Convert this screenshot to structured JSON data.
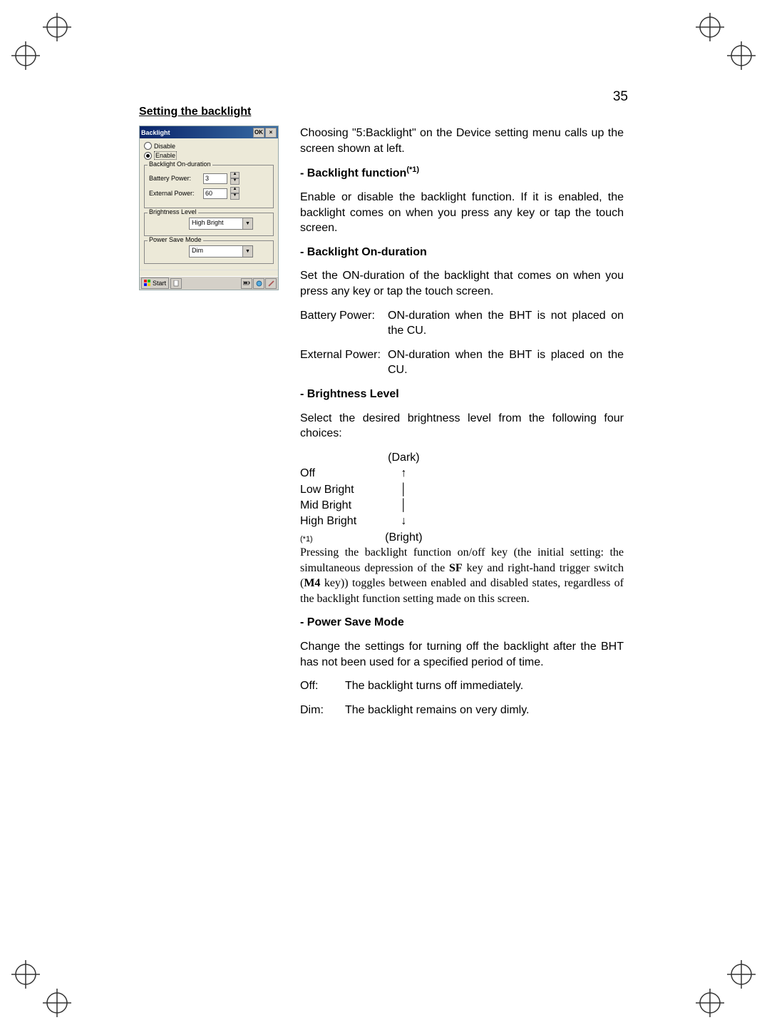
{
  "page_number": "35",
  "section_title": "Setting the backlight",
  "right": {
    "intro": "Choosing \"5:Backlight\" on the Device setting menu calls up the screen shown at left.",
    "h_function": "- Backlight function",
    "sup1": "(*1)",
    "p_function": "Enable or disable the backlight function. If it is enabled, the backlight comes on when you press any key or tap the touch screen.",
    "h_duration": "- Backlight On-duration",
    "p_duration": "Set the ON-duration of the backlight that comes on when you press any key or tap the touch screen.",
    "battery_label": "Battery Power:",
    "battery_desc": "ON-duration when the BHT is not placed on the CU.",
    "external_label": "External Power:",
    "external_desc": "ON-duration when the BHT is placed on the CU.",
    "h_brightness": "- Brightness Level",
    "p_brightness": "Select the desired brightness level from the following four choices:",
    "bl_dark": "(Dark)",
    "bl_bright": "(Bright)",
    "bl_off": "Off",
    "bl_low": "Low Bright",
    "bl_mid": "Mid Bright",
    "bl_high": "High Bright",
    "bl_up": "↑",
    "bl_pipe": "│",
    "bl_down": "↓",
    "footnote_marker": "(*1)",
    "footnote_pre": "Pressing the backlight function on/off key (the initial setting: the simultaneous depression of the ",
    "footnote_sf": "SF",
    "footnote_mid": " key and right-hand trigger switch (",
    "footnote_m4": "M4",
    "footnote_post": " key)) toggles between enabled and disabled states, regardless of the backlight function setting made on this screen.",
    "h_powersave": "- Power Save Mode",
    "p_powersave": "Change the settings for turning off the backlight after the BHT has not been used for a specified period of time.",
    "off_label": "Off:",
    "off_desc": "The backlight turns off immediately.",
    "dim_label": "Dim:",
    "dim_desc": "The backlight remains on very dimly."
  },
  "screenshot": {
    "title": "Backlight",
    "ok": "OK",
    "close": "×",
    "disable": "Disable",
    "enable": "Enable",
    "group_duration": "Backlight On-duration",
    "battery_power": "Battery Power:",
    "battery_val": "3",
    "external_power": "External Power:",
    "external_val": "60",
    "group_brightness": "Brightness Level",
    "brightness_val": "High Bright",
    "group_powersave": "Power Save Mode",
    "powersave_val": "Dim",
    "start": "Start"
  }
}
